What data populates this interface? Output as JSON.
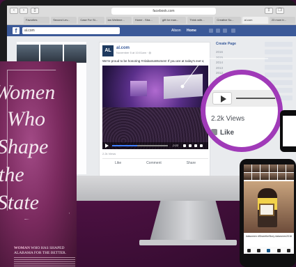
{
  "browser": {
    "url": "facebook.com",
    "tabs": [
      "Favorites",
      "Second Lev...",
      "Case For St...",
      "ian Wellene...",
      "Home - Stra...",
      "gift for man...",
      "Think with...",
      "Creative Su...",
      "al.com",
      "23 mom tr..."
    ]
  },
  "facebook": {
    "search_value": "al.com",
    "user_name": "Alison",
    "home_label": "Home"
  },
  "post": {
    "avatar_text": "AL",
    "page_name": "al.com",
    "timestamp": "November 5 at 10:01am · ",
    "text": "We're proud to be honoring #AlabamaWomen! If you are at today's event,",
    "video_time": "-2:22",
    "views": "2.2k Views",
    "actions": [
      "Like",
      "Comment",
      "Share"
    ],
    "progress": 0.45
  },
  "right_column": {
    "create_page": "Create Page",
    "years": [
      "2016",
      "2015",
      "2014",
      "2013",
      "2012",
      "2011",
      "2010",
      "2009",
      "2008",
      "2007",
      "2006"
    ]
  },
  "magnifier": {
    "views": "2.2k Views",
    "like": "Like"
  },
  "magazine": {
    "title_lines": [
      "Women",
      "Who",
      "Shape",
      "the",
      "State"
    ],
    "caption_prefix": "WOMAN",
    "caption_line1": "WHO HAS SHAPED",
    "caption_line2": "ALABAMA FOR THE BETTER."
  },
  "instagram": {
    "caption": "#alwomen #SharetheStory #alwomen2016"
  },
  "colors": {
    "facebook_blue": "#3b5998",
    "magnifier_ring": "#a03ab8",
    "magazine_magenta": "#7a2a5e"
  }
}
